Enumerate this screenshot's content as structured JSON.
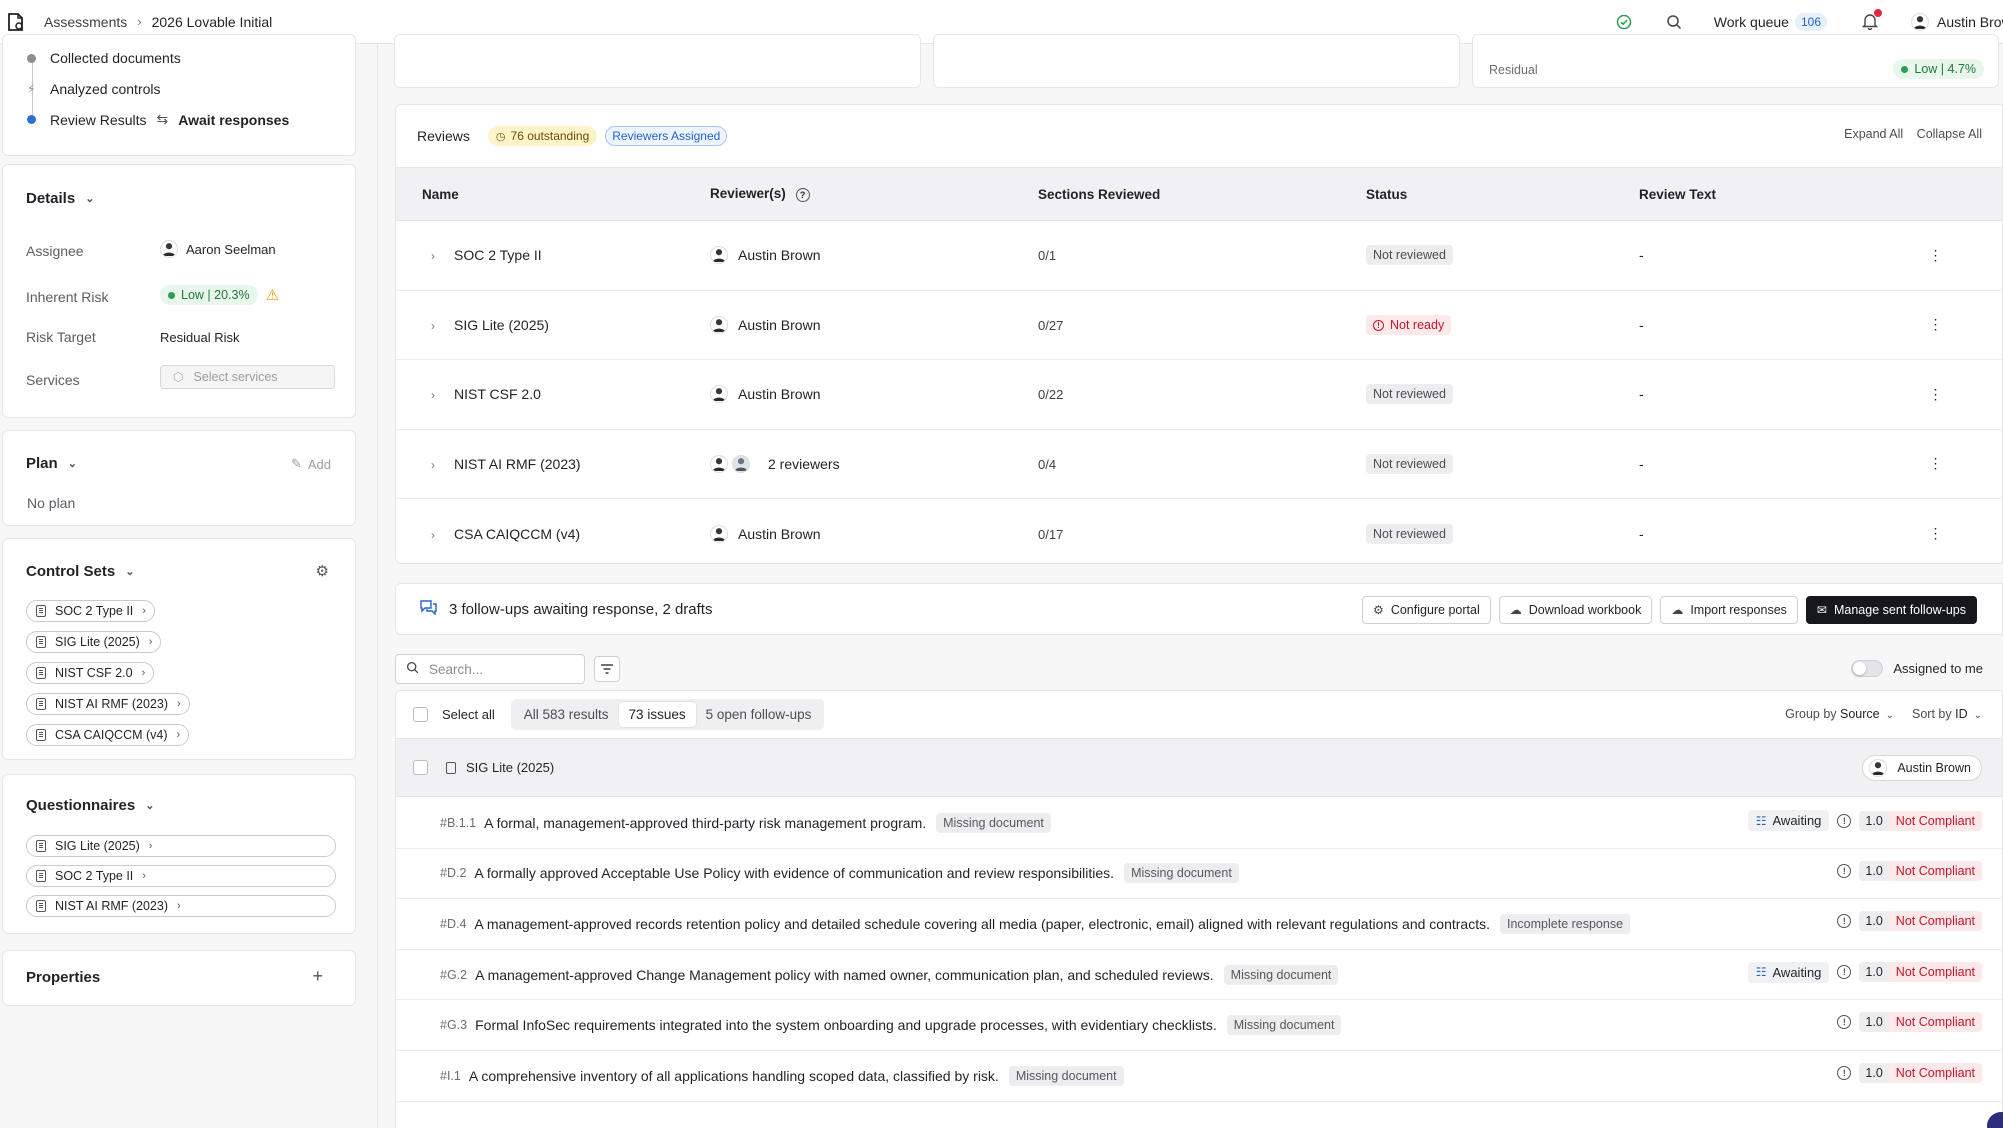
{
  "breadcrumb": {
    "parent": "Assessments",
    "current": "2026 Lovable Initial"
  },
  "topbar": {
    "work_queue_label": "Work queue",
    "work_queue_count": "106",
    "user_name": "Austin Brown",
    "icons": [
      "check-circle-icon",
      "search-icon",
      "bell-icon"
    ]
  },
  "steps": {
    "collected": "Collected documents",
    "analyzed": "Analyzed controls",
    "review": "Review Results",
    "await": "Await responses"
  },
  "details": {
    "title": "Details",
    "assignee_label": "Assignee",
    "assignee_value": "Aaron Seelman",
    "inherent_risk_label": "Inherent Risk",
    "inherent_risk_value": "Low | 20.3%",
    "risk_target_label": "Risk Target",
    "risk_target_value": "Residual Risk",
    "services_label": "Services",
    "services_placeholder": "Select services"
  },
  "plan": {
    "title": "Plan",
    "add_label": "Add",
    "empty": "No plan"
  },
  "control_sets": {
    "title": "Control Sets",
    "items": [
      "SOC 2 Type II",
      "SIG Lite (2025)",
      "NIST CSF 2.0",
      "NIST AI RMF (2023)",
      "CSA CAIQCCM (v4)"
    ]
  },
  "questionnaires": {
    "title": "Questionnaires",
    "items": [
      "SIG Lite (2025)",
      "SOC 2 Type II",
      "NIST AI RMF (2023)"
    ]
  },
  "properties": {
    "title": "Properties"
  },
  "residual": {
    "label": "Residual",
    "value": "Low | 4.7%"
  },
  "reviews": {
    "title": "Reviews",
    "outstanding": "76 outstanding",
    "reviewers_assigned": "Reviewers Assigned",
    "expand_all": "Expand All",
    "collapse_all": "Collapse All",
    "columns": [
      "Name",
      "Reviewer(s)",
      "Sections Reviewed",
      "Status",
      "Review Text"
    ],
    "rows": [
      {
        "name": "SOC 2 Type II",
        "reviewer": "Austin Brown",
        "sections": "0/1",
        "status": "Not reviewed",
        "text": "-"
      },
      {
        "name": "SIG Lite (2025)",
        "reviewer": "Austin Brown",
        "sections": "0/27",
        "status": "Not ready",
        "text": "-"
      },
      {
        "name": "NIST CSF 2.0",
        "reviewer": "Austin Brown",
        "sections": "0/22",
        "status": "Not reviewed",
        "text": "-"
      },
      {
        "name": "NIST AI RMF (2023)",
        "reviewer": "2 reviewers",
        "sections": "0/4",
        "status": "Not reviewed",
        "text": "-"
      },
      {
        "name": "CSA CAIQCCM (v4)",
        "reviewer": "Austin Brown",
        "sections": "0/17",
        "status": "Not reviewed",
        "text": "-"
      }
    ]
  },
  "followups": {
    "summary": "3 follow-ups awaiting response, 2 drafts",
    "configure_portal": "Configure portal",
    "download_workbook": "Download workbook",
    "import_responses": "Import responses",
    "manage_sent": "Manage sent follow-ups"
  },
  "filters": {
    "search_placeholder": "Search...",
    "assigned_to_me": "Assigned to me",
    "select_all": "Select all",
    "tabs": [
      "All 583 results",
      "73 issues",
      "5 open follow-ups"
    ],
    "group_by_label": "Group by",
    "group_by_value": "Source",
    "sort_by_label": "Sort by",
    "sort_by_value": "ID"
  },
  "group": {
    "title": "SIG Lite (2025)",
    "assignee": "Austin Brown"
  },
  "issues": [
    {
      "id": "#B.1.1",
      "text": "A formal, management-approved third-party risk management program.",
      "tag": "Missing document",
      "awaiting": "Awaiting",
      "score": "1.0",
      "status": "Not Compliant"
    },
    {
      "id": "#D.2",
      "text": "A formally approved Acceptable Use Policy with evidence of communication and review responsibilities.",
      "tag": "Missing document",
      "awaiting": "",
      "score": "1.0",
      "status": "Not Compliant"
    },
    {
      "id": "#D.4",
      "text": "A management-approved records retention policy and detailed schedule covering all media (paper, electronic, email) aligned with relevant regulations and contracts.",
      "tag": "Incomplete response",
      "awaiting": "",
      "score": "1.0",
      "status": "Not Compliant"
    },
    {
      "id": "#G.2",
      "text": "A management-approved Change Management policy with named owner, communication plan, and scheduled reviews.",
      "tag": "Missing document",
      "awaiting": "Awaiting",
      "score": "1.0",
      "status": "Not Compliant"
    },
    {
      "id": "#G.3",
      "text": "Formal InfoSec requirements integrated into the system onboarding and upgrade processes, with evidentiary checklists.",
      "tag": "Missing document",
      "awaiting": "",
      "score": "1.0",
      "status": "Not Compliant"
    },
    {
      "id": "#I.1",
      "text": "A comprehensive inventory of all applications handling scoped data, classified by risk.",
      "tag": "Missing document",
      "awaiting": "",
      "score": "1.0",
      "status": "Not Compliant"
    }
  ],
  "colors": {
    "accent_blue": "#2463c7",
    "danger": "#c0172c",
    "success": "#2aa04d",
    "dark_button": "#16181c"
  }
}
